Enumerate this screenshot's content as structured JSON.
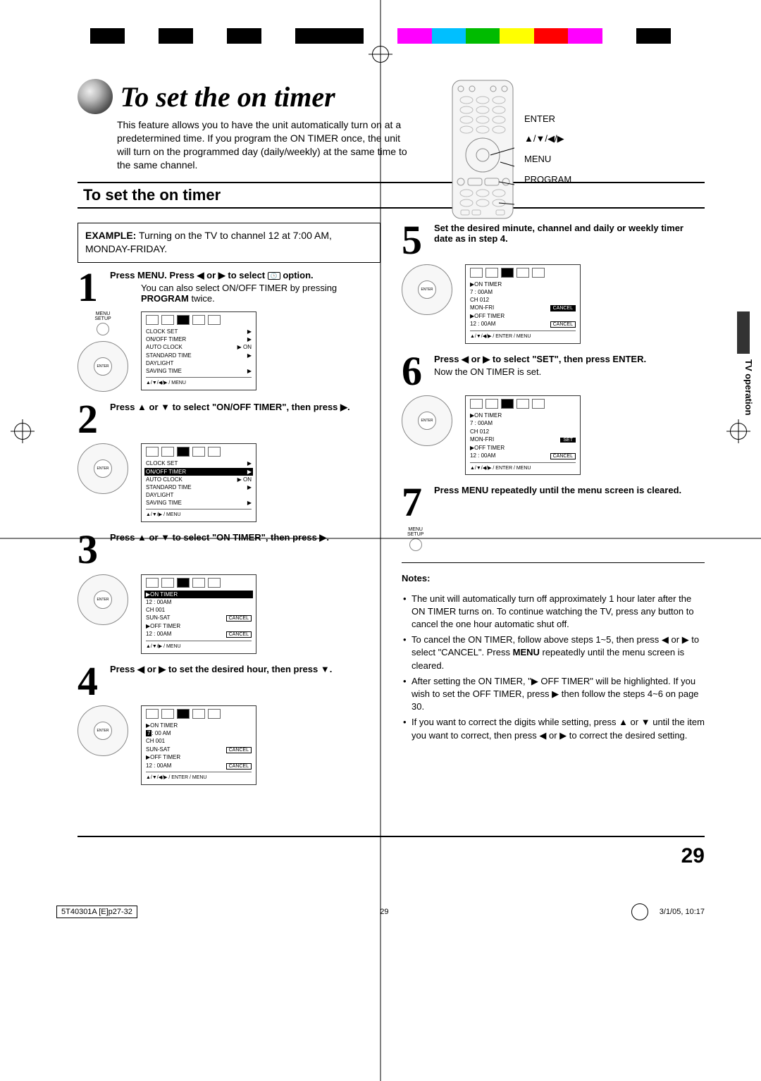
{
  "colorbar": [
    "#fff",
    "#000",
    "#fff",
    "#000",
    "#fff",
    "#000",
    "#fff",
    "#000",
    "#000",
    "#fff",
    "#f0f",
    "#00bfff",
    "#0b0",
    "#ff0",
    "#f00",
    "#f0f",
    "#fff",
    "#000",
    "#fff"
  ],
  "header": {
    "main_title": "To set the on timer",
    "intro": "This feature allows you to have the unit automatically turn on at a predetermined time. If you program the ON TIMER once, the unit will turn on the programmed day (daily/weekly) at the same time to the same channel."
  },
  "remote_labels": {
    "enter": "ENTER",
    "arrows": "▲/▼/◀/▶",
    "menu": "MENU",
    "program": "PROGRAM"
  },
  "section_title": "To set the on timer",
  "example": {
    "label": "EXAMPLE:",
    "text": "Turning on the TV to channel 12 at 7:00 AM, MONDAY-FRIDAY."
  },
  "steps": {
    "s1": {
      "lead_a": "Press MENU. Press ◀ or ▶ to select ",
      "lead_b": " option.",
      "clock_icon": "🕒",
      "sub": "You can also select ON/OFF TIMER by pressing PROGRAM twice.",
      "setup_btn": "MENU\nSETUP"
    },
    "s2": {
      "lead": "Press ▲ or ▼ to select \"ON/OFF TIMER\", then press ▶."
    },
    "s3": {
      "lead": "Press ▲ or ▼ to select \"ON TIMER\", then press ▶."
    },
    "s4": {
      "lead": "Press ◀ or ▶ to set the desired hour, then press ▼."
    },
    "s5": {
      "lead": "Set the desired minute, channel and daily or weekly timer date as in step 4."
    },
    "s6": {
      "lead": "Press ◀ or ▶ to select \"SET\", then press ENTER.",
      "sub": "Now the ON TIMER is set."
    },
    "s7": {
      "lead": "Press MENU repeatedly until the menu screen is cleared.",
      "setup_btn": "MENU\nSETUP"
    }
  },
  "osd1": {
    "rows": [
      {
        "l": "CLOCK SET",
        "r": "▶"
      },
      {
        "l": "ON/OFF TIMER",
        "r": "▶"
      },
      {
        "l": "AUTO CLOCK",
        "r": "▶ ON"
      },
      {
        "l": "STANDARD TIME",
        "r": "▶"
      },
      {
        "l": "DAYLIGHT",
        "r": ""
      },
      {
        "l": "  SAVING TIME",
        "r": "▶"
      }
    ],
    "ft": "▲/▼/◀/▶ / MENU"
  },
  "osd2": {
    "rows": [
      {
        "l": "CLOCK SET",
        "r": "▶"
      },
      {
        "l": "ON/OFF TIMER",
        "r": "▶",
        "hl": true
      },
      {
        "l": "AUTO CLOCK",
        "r": "▶ ON"
      },
      {
        "l": "STANDARD TIME",
        "r": "▶"
      },
      {
        "l": "DAYLIGHT",
        "r": ""
      },
      {
        "l": "  SAVING TIME",
        "r": "▶"
      }
    ],
    "ft": "▲/▼/▶ / MENU"
  },
  "osd3": {
    "rows": [
      {
        "l": "▶ON TIMER",
        "r": "",
        "hl": true
      },
      {
        "l": "  12 : 00AM",
        "r": ""
      },
      {
        "l": "  CH 001",
        "r": ""
      },
      {
        "l": "  SUN-SAT",
        "r": "CANCEL"
      },
      {
        "l": "▶OFF TIMER",
        "r": ""
      },
      {
        "l": "  12 : 00AM",
        "r": "CANCEL"
      }
    ],
    "ft": "▲/▼/▶ / MENU"
  },
  "osd4": {
    "rows": [
      {
        "l": "▶ON TIMER",
        "r": ""
      },
      {
        "l": "  [7]: 00 AM",
        "r": "",
        "hlbox": true
      },
      {
        "l": "  CH 001",
        "r": ""
      },
      {
        "l": "  SUN-SAT",
        "r": "CANCEL"
      },
      {
        "l": "▶OFF TIMER",
        "r": ""
      },
      {
        "l": "  12 : 00AM",
        "r": "CANCEL"
      }
    ],
    "ft": "▲/▼/◀/▶ / ENTER / MENU"
  },
  "osd5": {
    "rows": [
      {
        "l": "▶ON TIMER",
        "r": ""
      },
      {
        "l": "  7 : 00AM",
        "r": ""
      },
      {
        "l": "  CH 012",
        "r": ""
      },
      {
        "l": "  MON-FRI",
        "r": "CANCEL",
        "cancel_sel": true
      },
      {
        "l": "▶OFF TIMER",
        "r": ""
      },
      {
        "l": "  12 : 00AM",
        "r": "CANCEL"
      }
    ],
    "ft": "▲/▼/◀/▶ / ENTER / MENU"
  },
  "osd6": {
    "rows": [
      {
        "l": "▶ON TIMER",
        "r": ""
      },
      {
        "l": "  7 : 00AM",
        "r": ""
      },
      {
        "l": "  CH 012",
        "r": ""
      },
      {
        "l": "  MON-FRI",
        "r": "SET",
        "set_sel": true
      },
      {
        "l": "▶OFF TIMER",
        "r": ""
      },
      {
        "l": "  12 : 00AM",
        "r": "CANCEL"
      }
    ],
    "ft": "▲/▼/◀/▶ / ENTER / MENU"
  },
  "notes_head": "Notes:",
  "notes": [
    "The unit will automatically turn off approximately 1 hour later after the ON TIMER turns on. To continue watching the TV, press any button to cancel the one hour automatic shut off.",
    "To cancel the ON TIMER, follow above steps 1~5, then press ◀ or ▶ to select \"CANCEL\". Press MENU repeatedly until the menu screen is cleared.",
    "After setting the ON TIMER, \"▶ OFF TIMER\" will be highlighted. If you wish to set the OFF TIMER, press ▶ then follow the steps 4~6 on page 30.",
    "If you want to correct the digits while setting, press ▲ or ▼ until the item you want to correct, then press ◀ or ▶ to correct the desired setting."
  ],
  "side_tab": "TV operation",
  "page_number": "29",
  "footer": {
    "file": "5T40301A [E]p27-32",
    "page": "29",
    "date": "3/1/05, 10:17"
  }
}
